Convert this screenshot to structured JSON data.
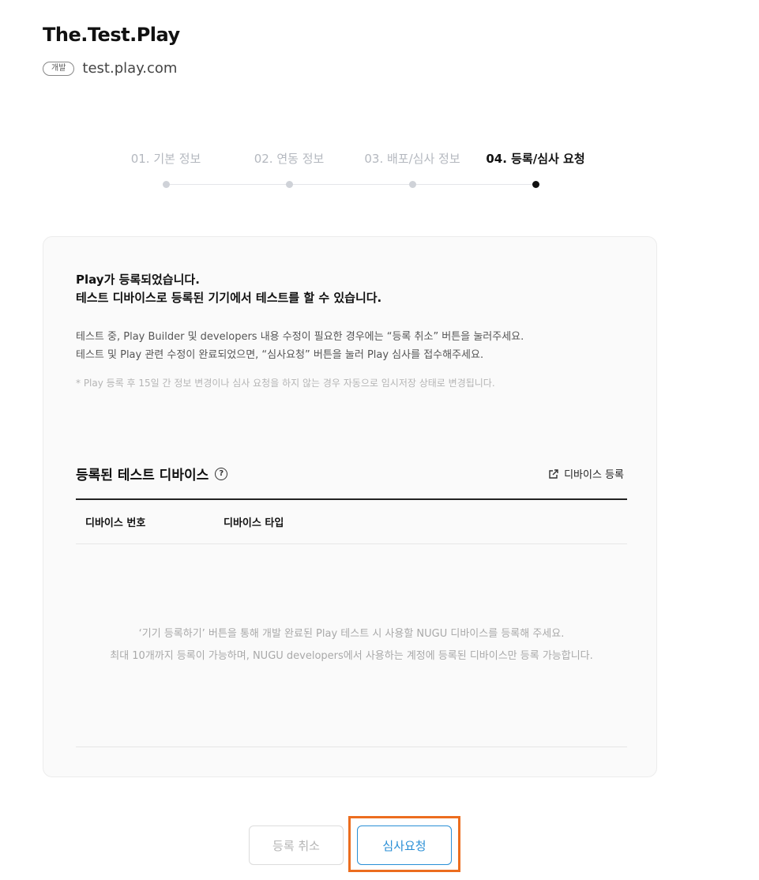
{
  "header": {
    "title": "The.Test.Play",
    "env_badge": "개발",
    "domain": "test.play.com"
  },
  "steps": [
    {
      "label": "01. 기본 정보",
      "active": false
    },
    {
      "label": "02. 연동 정보",
      "active": false
    },
    {
      "label": "03. 배포/심사 정보",
      "active": false
    },
    {
      "label": "04. 등록/심사 요청",
      "active": true
    }
  ],
  "card": {
    "headline_1": "Play가 등록되었습니다.",
    "headline_2": "테스트 디바이스로 등록된 기기에서 테스트를 할 수 있습니다.",
    "desc_1": "테스트 중, Play Builder 및 developers 내용 수정이 필요한 경우에는 “등록 취소” 버튼을 눌러주세요.",
    "desc_2": "테스트 및 Play 관련 수정이 완료되었으면, “심사요청” 버튼을 눌러 Play 심사를 접수해주세요.",
    "note": "* Play 등록 후 15일 간 정보 변경이나 심사 요청을 하지 않는 경우 자동으로 임시저장 상태로 변경됩니다."
  },
  "devices": {
    "section_title": "등록된 테스트 디바이스",
    "help_icon_glyph": "?",
    "register_link": "디바이스 등록",
    "columns": [
      "디바이스 번호",
      "디바이스 타입"
    ],
    "empty_1": "‘기기 등록하기’ 버튼을 통해 개발 완료된 Play 테스트 시 사용할 NUGU 디바이스를 등록해 주세요.",
    "empty_2": "최대 10개까지 등록이 가능하며, NUGU developers에서 사용하는 계정에 등록된 디바이스만 등록 가능합니다."
  },
  "actions": {
    "cancel_label": "등록 취소",
    "submit_label": "심사요청",
    "highlight_color": "#ec6d1f",
    "accent_color": "#2a8fd6"
  }
}
